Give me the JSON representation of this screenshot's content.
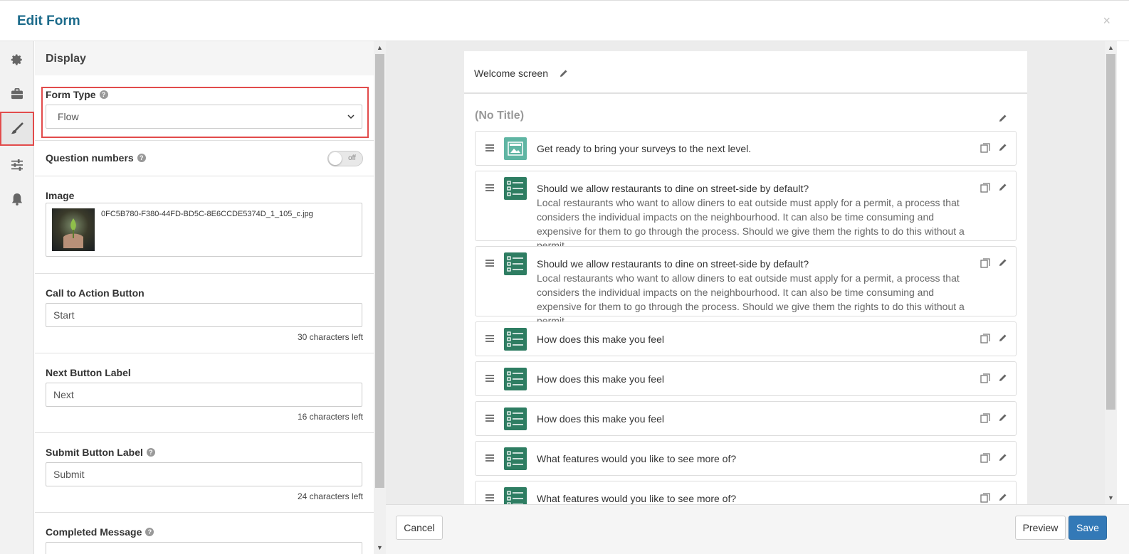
{
  "header": {
    "title": "Edit Form",
    "close": "×"
  },
  "sidebar_icons": [
    "gear-icon",
    "briefcase-icon",
    "paintbrush-icon",
    "sliders-icon",
    "bell-icon"
  ],
  "display": {
    "heading": "Display",
    "form_type": {
      "label": "Form Type",
      "value": "Flow"
    },
    "question_numbers": {
      "label": "Question numbers",
      "toggle": "off"
    },
    "image": {
      "label": "Image",
      "filename": "0FC5B780-F380-44FD-BD5C-8E6CCDE5374D_1_105_c.jpg"
    },
    "cta": {
      "label": "Call to Action Button",
      "value": "Start",
      "counter": "30 characters left"
    },
    "next": {
      "label": "Next Button Label",
      "value": "Next",
      "counter": "16 characters left"
    },
    "submit": {
      "label": "Submit Button Label",
      "value": "Submit",
      "counter": "24 characters left"
    },
    "completed": {
      "label": "Completed Message"
    }
  },
  "preview": {
    "welcome": "Welcome screen",
    "section_title": "(No Title)",
    "questions": [
      {
        "type": "image",
        "title": "Get ready to bring your surveys to the next level.",
        "desc": ""
      },
      {
        "type": "list",
        "title": "Should we allow restaurants to dine on street-side by default?",
        "desc": "Local restaurants who want to allow diners to eat outside must apply for a permit, a process that considers the individual impacts on the neighbourhood. It can also be time consuming and expensive for them to go through the process. Should we give them the rights to do this without a permit"
      },
      {
        "type": "list",
        "title": "Should we allow restaurants to dine on street-side by default?",
        "desc": "Local restaurants who want to allow diners to eat outside must apply for a permit, a process that considers the individual impacts on the neighbourhood. It can also be time consuming and expensive for them to go through the process. Should we give them the rights to do this without a permit"
      },
      {
        "type": "list",
        "title": "How does this make you feel",
        "desc": ""
      },
      {
        "type": "list",
        "title": "How does this make you feel",
        "desc": ""
      },
      {
        "type": "list",
        "title": "How does this make you feel",
        "desc": ""
      },
      {
        "type": "list",
        "title": "What features would you like to see more of?",
        "desc": ""
      },
      {
        "type": "list",
        "title": "What features would you like to see more of?",
        "desc": ""
      }
    ]
  },
  "footer": {
    "cancel": "Cancel",
    "preview": "Preview",
    "save": "Save"
  },
  "colors": {
    "accent": "#1b6a8a",
    "icon_green": "#2e7d62",
    "primary": "#3379b7",
    "highlight": "#e24b4b"
  }
}
